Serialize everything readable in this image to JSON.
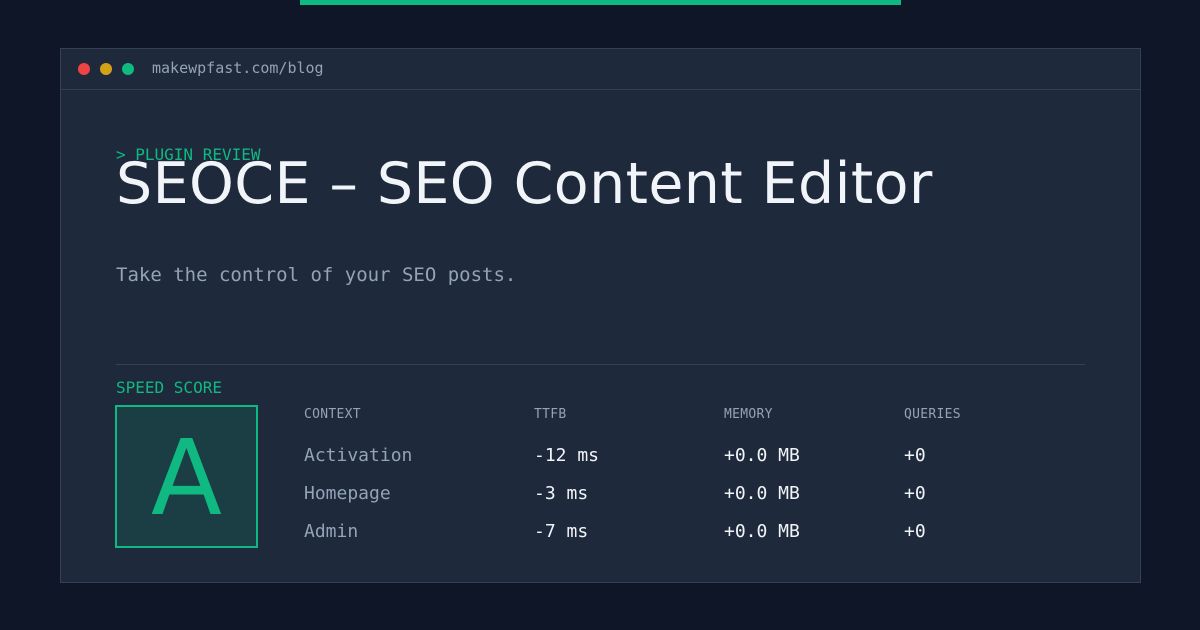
{
  "window": {
    "url": "makewpfast.com/blog",
    "controls": [
      {
        "name": "close",
        "color": "#ef4444"
      },
      {
        "name": "minimize",
        "color": "#d4a017"
      },
      {
        "name": "maximize",
        "color": "#10b981"
      }
    ]
  },
  "article": {
    "kicker": "> PLUGIN REVIEW",
    "title": "SEOCE – SEO Content Editor",
    "subtitle": "Take the control of your SEO posts."
  },
  "speed": {
    "label": "SPEED SCORE",
    "grade": "A"
  },
  "table": {
    "headers": [
      "CONTEXT",
      "TTFB",
      "MEMORY",
      "QUERIES"
    ],
    "rows": [
      [
        "Activation",
        "-12 ms",
        "+0.0 MB",
        "+0"
      ],
      [
        "Homepage",
        "-3 ms",
        "+0.0 MB",
        "+0"
      ],
      [
        "Admin",
        "-7 ms",
        "+0.0 MB",
        "+0"
      ]
    ]
  },
  "colors": {
    "accent": "#10b981",
    "background": "#0e1628",
    "panel": "#1e293b",
    "muted_text": "#94a3b8",
    "text": "#f1f5f9"
  }
}
